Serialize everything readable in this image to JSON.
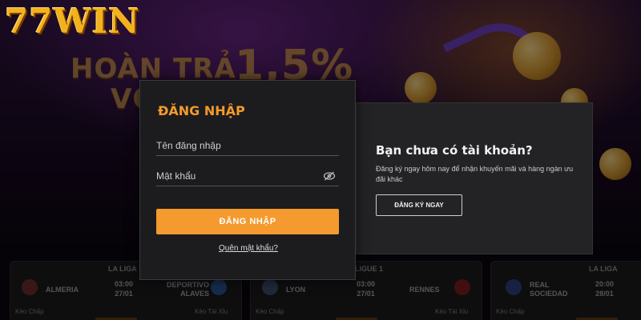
{
  "brand": {
    "logo": "77WIN"
  },
  "promo": {
    "line1": "HOÀN TRẢ",
    "big": "1,5%",
    "line2": "VỚ"
  },
  "login": {
    "title": "ĐĂNG NHẬP",
    "username_placeholder": "Tên đăng nhập",
    "password_placeholder": "Mật khẩu",
    "submit_label": "ĐĂNG NHẬP",
    "forgot_label": "Quên mật khẩu?",
    "eye_icon": "eye-slash-icon"
  },
  "register": {
    "title": "Bạn chưa có tài khoản?",
    "description": "Đăng ký ngay hôm nay để nhận khuyến mãi và hàng ngàn ưu đãi khác",
    "button_label": "ĐĂNG KÝ NGAY"
  },
  "matches": [
    {
      "league": "LA LIGA",
      "home": "ALMERIA",
      "away": "DEPORTIVO ALAVES",
      "time": "03:00",
      "date": "27/01",
      "bet_left": "Kèo Chấp",
      "bet_right": "Kèo Tài Xỉu"
    },
    {
      "league": "LIGUE 1",
      "home": "LYON",
      "away": "RENNES",
      "time": "03:00",
      "date": "27/01",
      "bet_left": "Kèo Chấp",
      "bet_right": "Kèo Tài Xỉu"
    },
    {
      "league": "LA LIGA",
      "home": "REAL SOCIEDAD",
      "away": "",
      "time": "20:00",
      "date": "28/01",
      "bet_left": "Kèo Chấp",
      "bet_right": ""
    }
  ],
  "colors": {
    "accent": "#f49a2e",
    "panel": "#1c1c1f",
    "logo": "#f2b21e"
  }
}
